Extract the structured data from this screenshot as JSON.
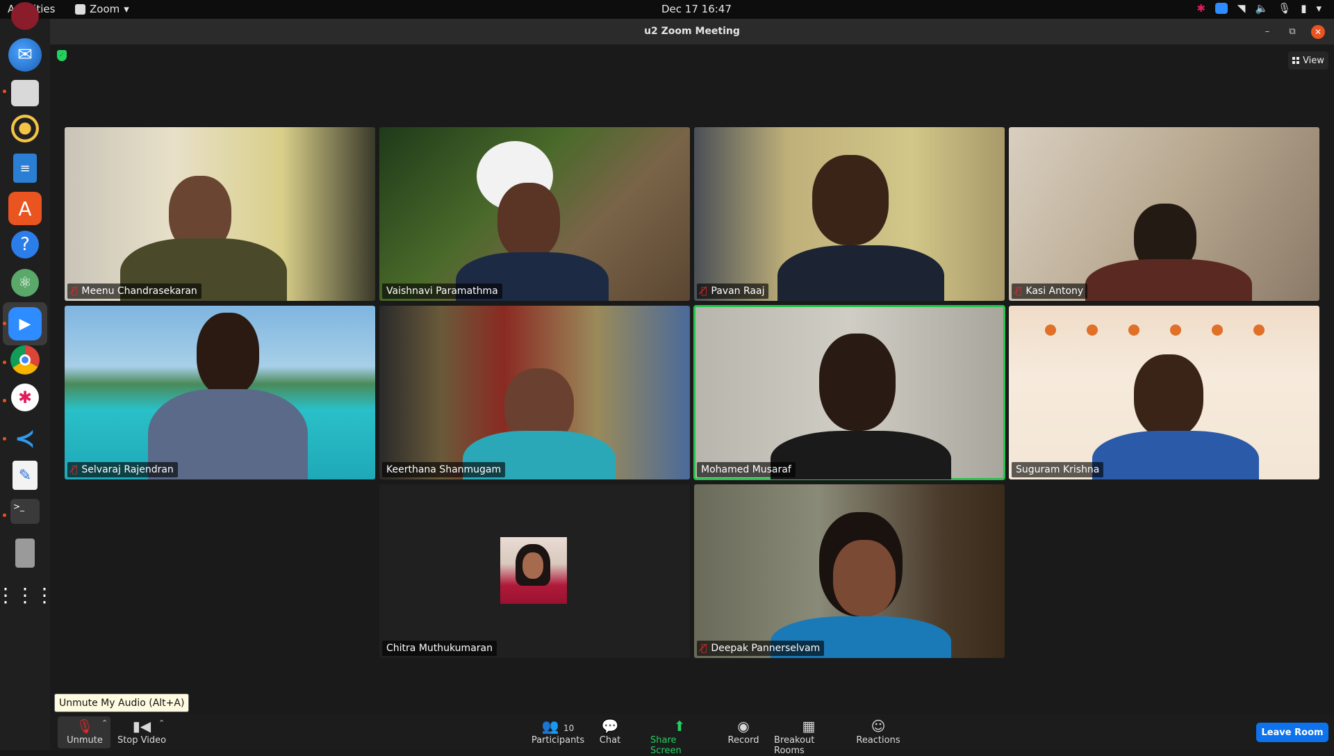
{
  "system_bar": {
    "activities": "Activities",
    "app_name": "Zoom",
    "app_caret": "▾",
    "clock": "Dec 17  16:47"
  },
  "window": {
    "title": "u2  Zoom Meeting",
    "view_label": "View"
  },
  "participants": [
    {
      "name": "Meenu Chandrasekaran",
      "muted": true
    },
    {
      "name": "Vaishnavi Paramathma",
      "muted": false
    },
    {
      "name": "Pavan Raaj",
      "muted": true
    },
    {
      "name": "Kasi Antony",
      "muted": true
    },
    {
      "name": "Selvaraj Rajendran",
      "muted": true
    },
    {
      "name": "Keerthana Shanmugam",
      "muted": false
    },
    {
      "name": "Mohamed Musaraf",
      "muted": false,
      "speaking": true
    },
    {
      "name": "Suguram Krishna",
      "muted": false
    },
    {
      "name": "Chitra Muthukumaran",
      "muted": false,
      "video_off": true
    },
    {
      "name": "Deepak Pannerselvam",
      "muted": true
    }
  ],
  "tooltip": "Unmute My Audio (Alt+A)",
  "toolbar": {
    "unmute": "Unmute",
    "stop_video": "Stop Video",
    "participants": "Participants",
    "participants_count": "10",
    "chat": "Chat",
    "share_screen": "Share Screen",
    "record": "Record",
    "breakout_rooms": "Breakout Rooms",
    "reactions": "Reactions",
    "leave_room": "Leave Room"
  },
  "colors": {
    "accent_blue": "#0e72ed",
    "speaking_green": "#27c24c",
    "share_green": "#23d160",
    "mute_red": "#e02828"
  },
  "icons": [
    "zoom-app-icon",
    "shield-icon",
    "grid-view-icon",
    "mic-muted-icon",
    "video-camera-icon",
    "participants-icon",
    "chat-icon",
    "share-screen-icon",
    "record-icon",
    "breakout-rooms-icon",
    "reactions-icon"
  ]
}
